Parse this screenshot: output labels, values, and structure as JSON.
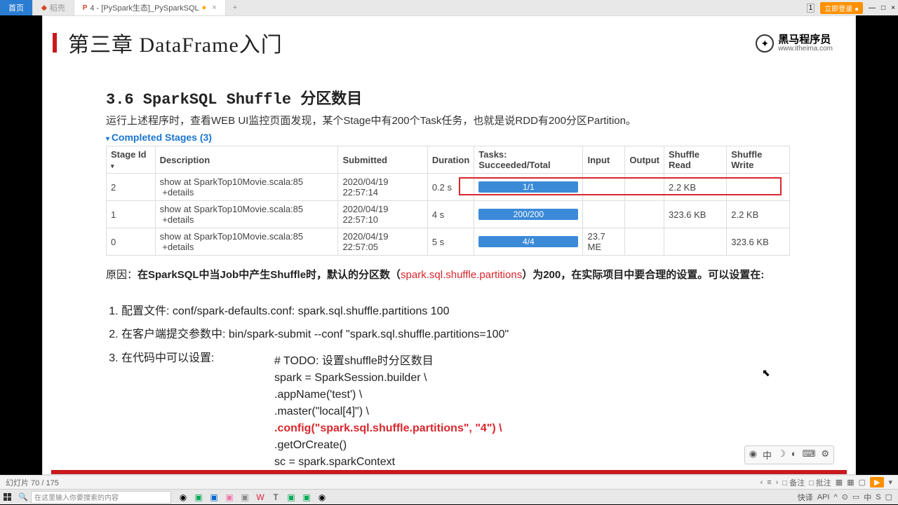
{
  "tabs": {
    "home": "首页",
    "ps": "稻壳",
    "active": "4 - [PySpark生态]_PySparkSQL"
  },
  "login": "立即登录",
  "chapter": "第三章 DataFrame入门",
  "brand": {
    "name": "黑马程序员",
    "url": "www.itheima.com"
  },
  "section_num": "3.6 SparkSQL Shuffle 分区数目",
  "intro": "运行上述程序时，查看WEB UI监控页面发现，某个Stage中有200个Task任务，也就是说RDD有200分区Partition。",
  "completed": "Completed Stages (3)",
  "table": {
    "headers": [
      "Stage Id",
      "Description",
      "Submitted",
      "Duration",
      "Tasks: Succeeded/Total",
      "Input",
      "Output",
      "Shuffle Read",
      "Shuffle Write"
    ],
    "rows": [
      {
        "id": "2",
        "desc": "show at SparkTop10Movie.scala:85",
        "details": "+details",
        "sub": "2020/04/19 22:57:14",
        "dur": "0.2 s",
        "tasks": "1/1",
        "input": "",
        "output": "",
        "sr": "2.2 KB",
        "sw": ""
      },
      {
        "id": "1",
        "desc": "show at SparkTop10Movie.scala:85",
        "details": "+details",
        "sub": "2020/04/19 22:57:10",
        "dur": "4 s",
        "tasks": "200/200",
        "input": "",
        "output": "",
        "sr": "323.6 KB",
        "sw": "2.2 KB"
      },
      {
        "id": "0",
        "desc": "show at SparkTop10Movie.scala:85",
        "details": "+details",
        "sub": "2020/04/19 22:57:05",
        "dur": "5 s",
        "tasks": "4/4",
        "input": "23.7 ME",
        "output": "",
        "sr": "",
        "sw": "323.6 KB"
      }
    ]
  },
  "reason": {
    "prefix": "原因：",
    "b1": "在SparkSQL中当Job中产生Shuffle时，默认的分区数（",
    "red": "spark.sql.shuffle.partitions",
    "b2": "）为200，在实际项目中要合理的设置。可以设置在:"
  },
  "list": [
    "配置文件: conf/spark-defaults.conf:     spark.sql.shuffle.partitions 100",
    "在客户端提交参数中: bin/spark-submit --conf \"spark.sql.shuffle.partitions=100\"",
    "在代码中可以设置:"
  ],
  "code": {
    "l1": "# TODO: 设置shuffle时分区数目",
    "l2": "spark = SparkSession.builder \\",
    "l3": "    .appName('test') \\",
    "l4": "    .master(\"local[4]\") \\",
    "l5": "    .config(\"spark.sql.shuffle.partitions\", \"4\") \\",
    "l6": "    .getOrCreate()",
    "l7": "sc = spark.sparkContext"
  },
  "status": {
    "slide": "幻灯片 70 / 175",
    "note": "备注",
    "tools": "批注"
  },
  "search_placeholder": "在这里输入你要搜索的内容",
  "tray": {
    "quick": "快译",
    "api": "API"
  }
}
